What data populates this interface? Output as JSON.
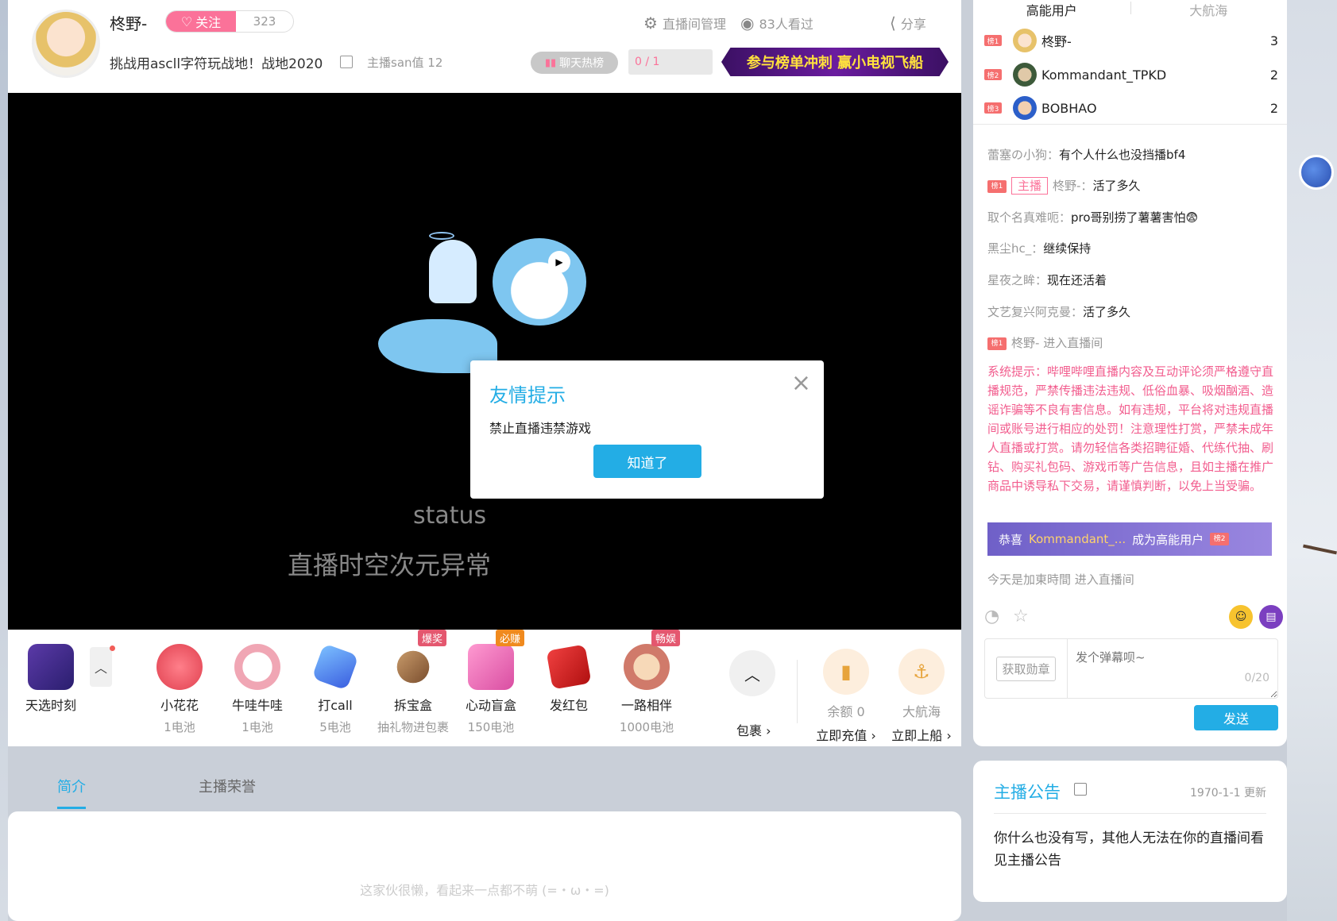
{
  "header": {
    "anchor_name": "柊野-",
    "follow_label": "关注",
    "follower_count": "323",
    "room_title": "挑战用ascll字符玩战地！战地2020",
    "san_label": "主播san值",
    "san_value": "12",
    "manage_label": "直播间管理",
    "viewers_label": "83人看过",
    "share_label": "分享",
    "chat_rank_label": "聊天热榜",
    "progress_text": "0 / 1",
    "promo_text": "参与榜单冲刺 赢小电视飞船"
  },
  "video": {
    "status_text": "status",
    "status_sub": "直播时空次元异常"
  },
  "modal": {
    "title": "友情提示",
    "message": "禁止直播违禁游戏",
    "confirm_label": "知道了",
    "close_icon": "×"
  },
  "gifts": {
    "first": {
      "name": "天选时刻"
    },
    "items": [
      {
        "name": "小花花",
        "price": "1电池",
        "tag": ""
      },
      {
        "name": "牛哇牛哇",
        "price": "1电池",
        "tag": ""
      },
      {
        "name": "打call",
        "price": "5电池",
        "tag": ""
      },
      {
        "name": "拆宝盒",
        "price": "抽礼物进包裹",
        "tag": "爆奖"
      },
      {
        "name": "心动盲盒",
        "price": "150电池",
        "tag": "必赚"
      },
      {
        "name": "发红包",
        "price": "",
        "tag": ""
      },
      {
        "name": "一路相伴",
        "price": "1000电池",
        "tag": "畅娱"
      }
    ],
    "pack_label": "包裹 ›",
    "balance_label": "余额 0",
    "recharge_label": "立即充值 ›",
    "guard_label": "大航海",
    "board_label": "立即上船 ›"
  },
  "tabs": {
    "intro": "简介",
    "honor": "主播荣誉"
  },
  "intro": {
    "empty_text": "这家伙很懒，看起来一点都不萌 (=・ω・=)"
  },
  "ranking": {
    "tab_high": "高能用户",
    "tab_guard": "大航海",
    "rows": [
      {
        "badge": "榜1",
        "name": "柊野-",
        "score": "3"
      },
      {
        "badge": "榜2",
        "name": "Kommandant_TPKD",
        "score": "2"
      },
      {
        "badge": "榜3",
        "name": "BOBHAO",
        "score": "2"
      }
    ]
  },
  "chat": {
    "messages": [
      {
        "user": "蕾塞の小狗：",
        "text": "有个人什么也没挡播bf4"
      },
      {
        "user": "柊野-：",
        "text": "活了多久",
        "host_tag": "主播",
        "badge": "榜1"
      },
      {
        "user": "取个名真难呃：",
        "text": "pro哥别捞了薯薯害怕😨"
      },
      {
        "user": "黑尘hc_：",
        "text": "继续保持"
      },
      {
        "user": "星夜之眸：",
        "text": "现在还活着"
      },
      {
        "user": "文艺复兴阿克曼：",
        "text": "活了多久"
      },
      {
        "user": "柊野-",
        "text": " 进入直播间",
        "badge": "榜1"
      }
    ],
    "system": "系统提示：哔哩哔哩直播内容及互动评论须严格遵守直播规范，严禁传播违法违规、低俗血暴、吸烟酗酒、造谣诈骗等不良有害信息。如有违规，平台将对违规直播间或账号进行相应的处罚！注意理性打赏，严禁未成年人直播或打赏。请勿轻信各类招聘征婚、代练代抽、刷钻、购买礼包码、游戏币等广告信息，且如主播在推广商品中诱导私下交易，请谨慎判断，以免上当受骗。",
    "congrats_prefix": "恭喜",
    "congrats_user": "Kommandant_...",
    "congrats_suffix": "成为高能用户",
    "congrats_badge": "榜2",
    "enter_user": "今天是加東時間",
    "enter_text": "进入直播间",
    "medal_label": "获取勋章",
    "input_placeholder": "发个弹幕呗~",
    "counter": "0/20",
    "send_label": "发送"
  },
  "notice": {
    "title": "主播公告",
    "date": "1970-1-1 更新",
    "body": "你什么也没有写，其他人无法在你的直播间看见主播公告"
  }
}
